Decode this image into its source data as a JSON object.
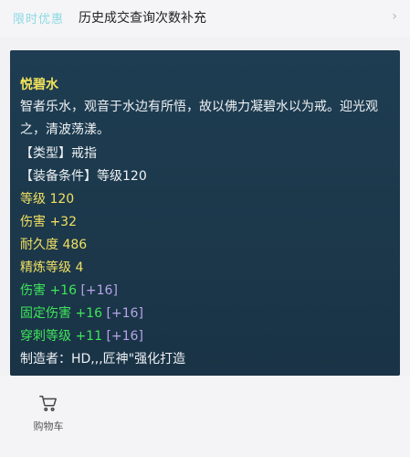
{
  "top_bar": {
    "badge": "限时优惠",
    "text": "历史成交查询次数补充",
    "chevron": "›"
  },
  "item": {
    "name": "悦碧水",
    "description": "智者乐水，观音于水边有所悟，故以佛力凝碧水以为戒。迎光观之，清波荡漾。",
    "type_line": "【类型】戒指",
    "requirement_line": "【装备条件】等级120",
    "level": "等级 120",
    "damage": "伤害 +32",
    "durability": "耐久度 486",
    "refine": "精炼等级 4",
    "bonus_damage": "伤害 +16",
    "bonus_damage_extra": "[+16]",
    "fixed_damage": "固定伤害 +16",
    "fixed_damage_extra": "[+16]",
    "pierce_level": "穿刺等级 +11",
    "pierce_level_extra": "[+16]",
    "maker": "制造者：HD,,,匠神\"强化打造"
  },
  "bottom_bar": {
    "cart_label": "购物车",
    "cart_icon": "shopping-cart-icon"
  }
}
